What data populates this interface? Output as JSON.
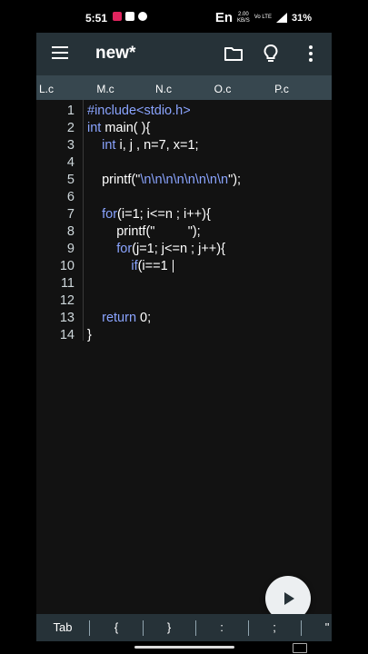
{
  "status_bar": {
    "time": "5:51",
    "language": "En",
    "speed_value": "2.00",
    "speed_unit": "KB/S",
    "network": "Vo LTE",
    "battery": "31%"
  },
  "app_bar": {
    "title": "new*"
  },
  "file_tabs": [
    "L.c",
    "M.c",
    "N.c",
    "O.c",
    "P.c"
  ],
  "editor": {
    "lines": [
      {
        "num": "1",
        "parts": [
          {
            "t": "#include<stdio.h>",
            "c": "kw"
          }
        ]
      },
      {
        "num": "2",
        "parts": [
          {
            "t": "int",
            "c": "kw"
          },
          {
            "t": " main( ){",
            "c": ""
          }
        ]
      },
      {
        "num": "3",
        "parts": [
          {
            "t": "    ",
            "c": ""
          },
          {
            "t": "int",
            "c": "kw"
          },
          {
            "t": " i, j , n=7, x=1;",
            "c": ""
          }
        ]
      },
      {
        "num": "4",
        "parts": []
      },
      {
        "num": "5",
        "parts": [
          {
            "t": "    printf(\"",
            "c": ""
          },
          {
            "t": "\\n\\n\\n\\n\\n\\n\\n\\n",
            "c": "kw"
          },
          {
            "t": "\");",
            "c": ""
          }
        ]
      },
      {
        "num": "6",
        "parts": []
      },
      {
        "num": "7",
        "parts": [
          {
            "t": "    ",
            "c": ""
          },
          {
            "t": "for",
            "c": "kw"
          },
          {
            "t": "(i=1; i<=n ; i++){",
            "c": ""
          }
        ]
      },
      {
        "num": "8",
        "parts": [
          {
            "t": "        printf(\"         \");",
            "c": ""
          }
        ]
      },
      {
        "num": "9",
        "parts": [
          {
            "t": "        ",
            "c": ""
          },
          {
            "t": "for",
            "c": "kw"
          },
          {
            "t": "(j=1; j<=n ; j++){",
            "c": ""
          }
        ]
      },
      {
        "num": "10",
        "parts": [
          {
            "t": "            ",
            "c": ""
          },
          {
            "t": "if",
            "c": "kw"
          },
          {
            "t": "(i==1 ",
            "c": ""
          }
        ],
        "cursor": true
      },
      {
        "num": "11",
        "parts": []
      },
      {
        "num": "12",
        "parts": []
      },
      {
        "num": "13",
        "parts": [
          {
            "t": "    ",
            "c": ""
          },
          {
            "t": "return",
            "c": "kw"
          },
          {
            "t": " 0;",
            "c": ""
          }
        ]
      },
      {
        "num": "14",
        "parts": [
          {
            "t": "}",
            "c": ""
          }
        ]
      }
    ]
  },
  "key_bar": {
    "keys": [
      "Tab",
      "{",
      "}",
      ":",
      ";",
      "\""
    ]
  },
  "colors": {
    "app_bar": "#263238",
    "tab_bar": "#37474f",
    "editor_bg": "#121212",
    "keyword": "#8aa4ff"
  }
}
